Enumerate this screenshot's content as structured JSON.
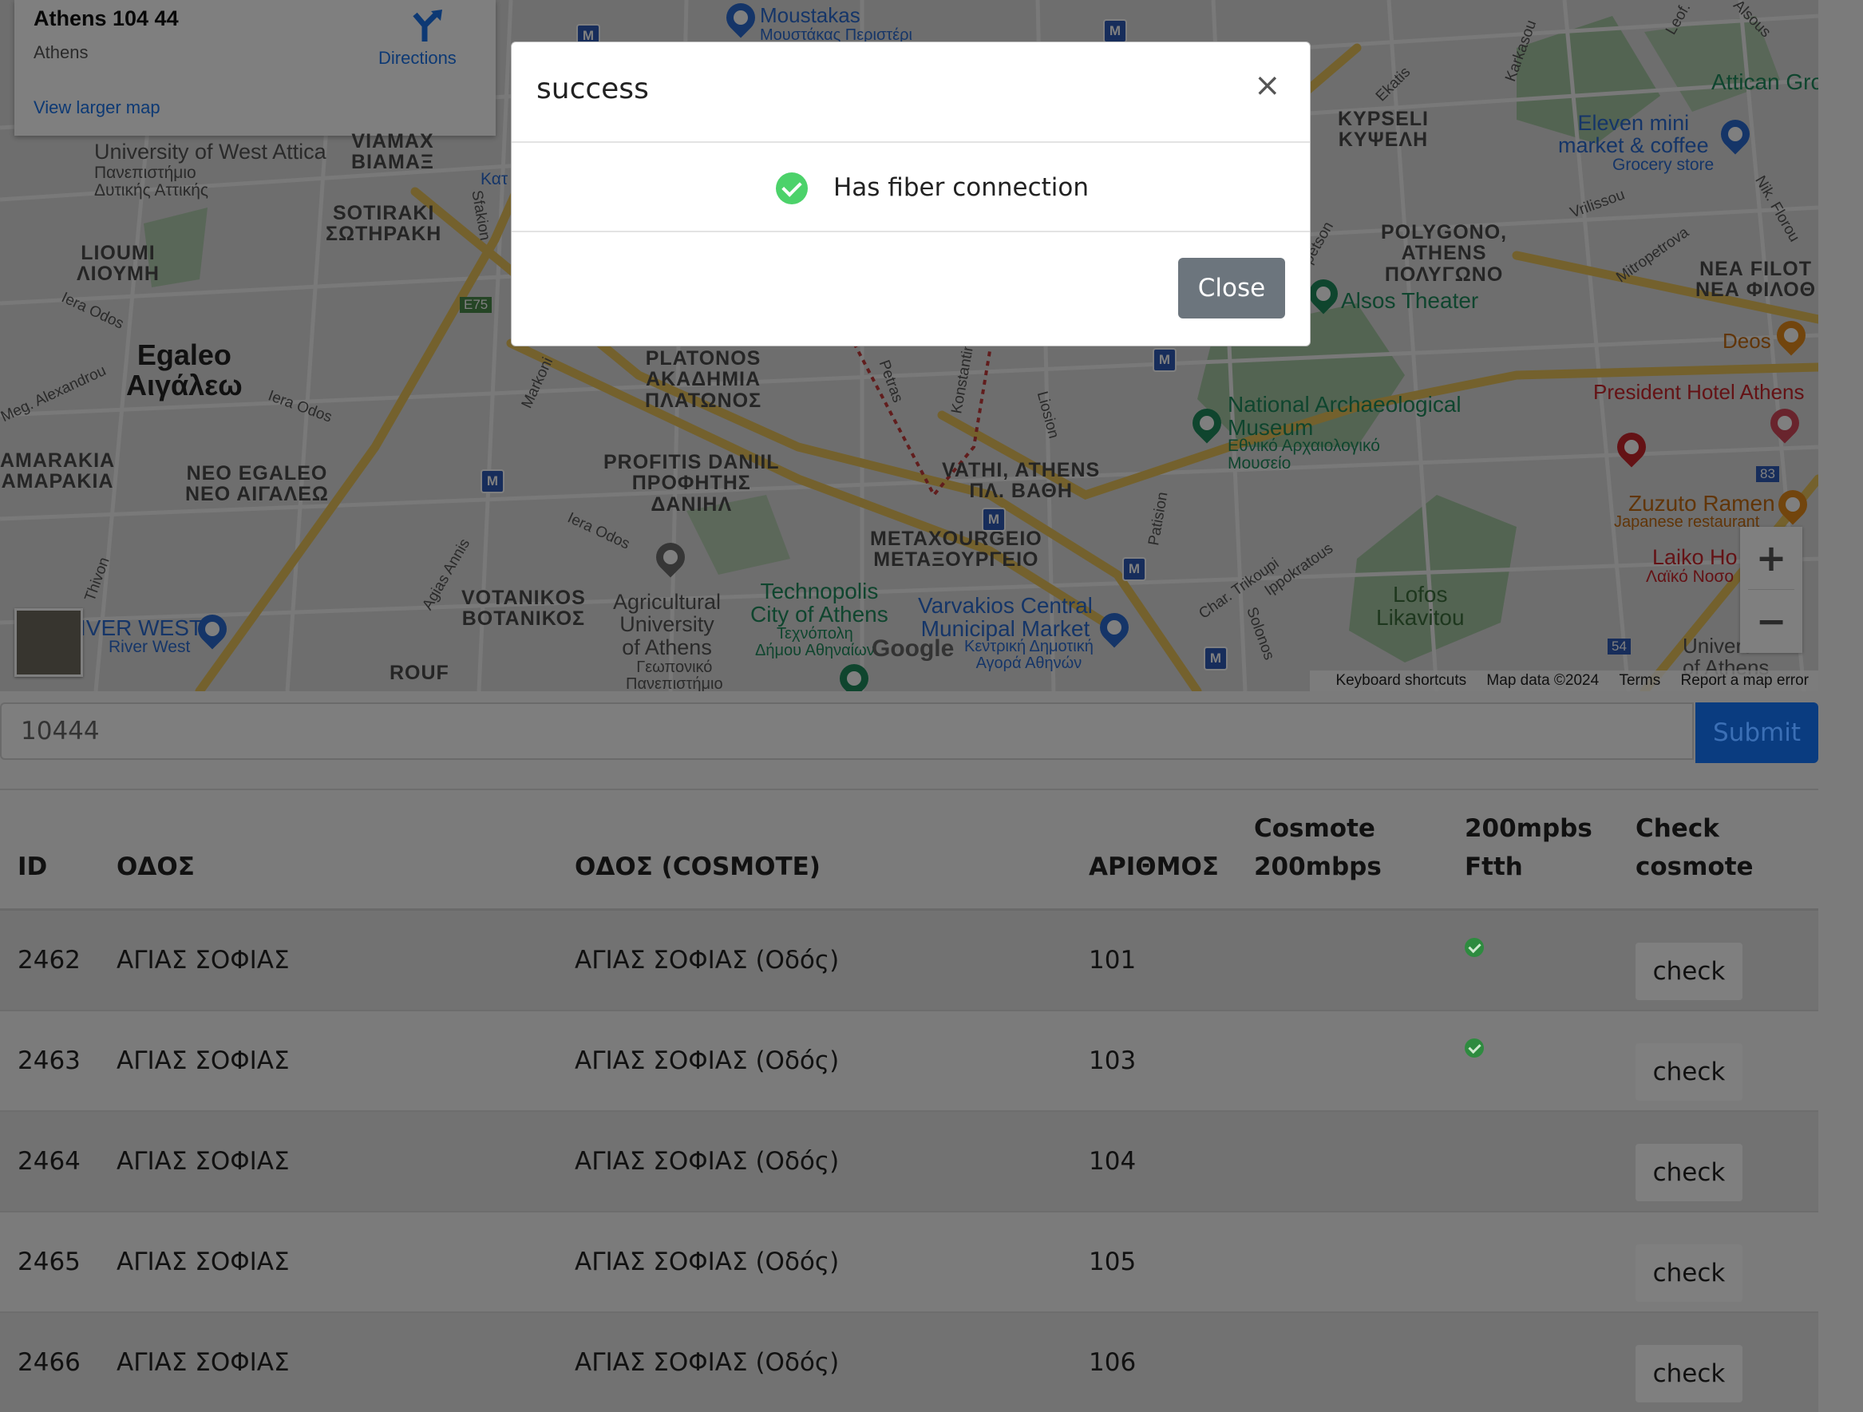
{
  "map": {
    "info_card": {
      "address": "Athens 104 44",
      "city": "Athens",
      "directions_label": "Directions",
      "larger_map_label": "View larger map"
    },
    "labels": {
      "moustakas": "Moustakas",
      "moustakas_gr": "Μουστάκας Περιστέρι",
      "university_wa": "University of West Attica",
      "university_wa_gr": "Πανεπιστήμιο\nΔυτικής Αττικής",
      "viamax": "VIAMAX\nΒΙΑΜΑΞ",
      "sotiraki": "SOTIRAKI\nΣΩΤΗΡΑΚΗ",
      "liomi": "LIOUMI\nΛΙΟΥΜΗ",
      "egaleo": "Egaleo\nΑιγάλεω",
      "amarakia": "AMARAKIA\nΑΜΑΡΑΚΙΑ",
      "neo_egaleo": "NEO EGALEO\nΝΕΟ ΑΙΓΑΛΕΩ",
      "platonos": "PLATONOS\nΑΚΑΔΗΜΙΑ\nΠΛΑΤΩΝΟΣ",
      "profitis": "PROFITIS DANIIL\nΠΡΟΦΗΤΗΣ\nΔΑΝΙΗΛ",
      "votanikos": "VOTANIKOS\nΒΟΤΑΝΙΚΟΣ",
      "agri_univ": "Agricultural\nUniversity\nof Athens",
      "agri_univ_gr": "Γεωπονικό\nΠανεπιστήμιο",
      "vathi": "VATHI, ATHENS\nΠΛ. ΒΑΘΗ",
      "metaxourgeio": "METAXOURGEIO\nΜΕΤΑΞΟΥΡΓΕΙΟ",
      "technopolis": "Technopolis\nCity of Athens",
      "technopolis_gr": "Τεχνόπολη\nΔήμου Αθηναίων",
      "varvakios": "Varvakios Central\nMunicipal Market",
      "varvakios_gr": "Κεντρική Δημοτική\nΑγορά Αθηνών",
      "river_west": "IVER WEST",
      "river_west_2": "River West",
      "rouf": "ROUF",
      "kypseli": "KYPSELI\nΚΥΨΕΛΗ",
      "polygono": "POLYGONO,\nATHENS\nΠΟΛΥΓΩΝΟ",
      "alsos": "Alsos Theater",
      "eleven": "Eleven mini\nmarket & coffee",
      "grocery": "Grocery store",
      "attican": "Attican Gro",
      "nea_filot": "ΝΕΑ FILOT\nΝΕΑ ΦΙΛΟΘ",
      "deos": "Deos",
      "president": "President Hotel Athens",
      "museum": "National Archaeological\nMuseum",
      "museum_gr": "Εθνικό Αρχαιολογικό\nΜουσείο",
      "zuzuto": "Zuzuto Ramen",
      "zuzuto_sub": "Japanese restaurant",
      "laiko": "Laiko Ho",
      "laiko_gr": "Λαϊκό Νοσο",
      "lofos": "Lofos\nLikavitou",
      "university_right": "Univers\nof Athens",
      "street_iera1": "Iera Odos",
      "street_iera2": "Iera Odos",
      "street_iera3": "Iera Odos",
      "street_meg_alex": "Meg. Alexandrou",
      "street_thivon": "Thivon",
      "street_markoni": "Markoni",
      "street_agias_annis": "Agias Annis",
      "street_petras": "Petras",
      "street_konstantin": "Konstantin",
      "street_liosion": "Liosion",
      "street_patision": "Patision",
      "street_char_trikoupi": "Char. Trikoupi",
      "street_ippokratous": "Ippokratous",
      "street_solonos": "Solonos",
      "street_sfakion": "Sfakion",
      "street_ekatis": "Ekatis",
      "street_karkasou": "Karkasou",
      "street_vrilissou": "Vrilissou",
      "street_mitropetrova": "Mitropetrova",
      "street_nik_florou": "Nik. Florou",
      "street_spetson": "Spetson",
      "street_leof": "Leof.",
      "street_alsous": "Alsous",
      "e75": "E75",
      "route_83": "83",
      "route_54": "54",
      "kat": "Κατ"
    },
    "google_logo": "Google",
    "footer": {
      "shortcuts": "Keyboard shortcuts",
      "map_data": "Map data ©2024",
      "terms": "Terms",
      "report": "Report a map error"
    },
    "zoom_in": "+",
    "zoom_out": "−"
  },
  "search": {
    "value": "10444",
    "submit_label": "Submit"
  },
  "table": {
    "headers": [
      "ID",
      "ΟΔΟΣ",
      "ΟΔΟΣ (COSMOTE)",
      "ΑΡΙΘΜΟΣ",
      "Cosmote 200mbps",
      "200mpbs Ftth",
      "Check cosmote"
    ],
    "header_lines": {
      "cosmote_1": "Cosmote",
      "cosmote_2": "200mbps",
      "ftth_1": "200mpbs",
      "ftth_2": "Ftth",
      "check_1": "Check",
      "check_2": "cosmote"
    },
    "rows": [
      {
        "id": "2462",
        "street": "ΑΓΙΑΣ ΣΟΦΙΑΣ",
        "street_cosmote": "ΑΓΙΑΣ ΣΟΦΙΑΣ (Οδός)",
        "number": "101",
        "cosmote_200": "",
        "ftth": true,
        "check_label": "check"
      },
      {
        "id": "2463",
        "street": "ΑΓΙΑΣ ΣΟΦΙΑΣ",
        "street_cosmote": "ΑΓΙΑΣ ΣΟΦΙΑΣ (Οδός)",
        "number": "103",
        "cosmote_200": "",
        "ftth": true,
        "check_label": "check"
      },
      {
        "id": "2464",
        "street": "ΑΓΙΑΣ ΣΟΦΙΑΣ",
        "street_cosmote": "ΑΓΙΑΣ ΣΟΦΙΑΣ (Οδός)",
        "number": "104",
        "cosmote_200": "",
        "ftth": false,
        "check_label": "check"
      },
      {
        "id": "2465",
        "street": "ΑΓΙΑΣ ΣΟΦΙΑΣ",
        "street_cosmote": "ΑΓΙΑΣ ΣΟΦΙΑΣ (Οδός)",
        "number": "105",
        "cosmote_200": "",
        "ftth": false,
        "check_label": "check"
      },
      {
        "id": "2466",
        "street": "ΑΓΙΑΣ ΣΟΦΙΑΣ",
        "street_cosmote": "ΑΓΙΑΣ ΣΟΦΙΑΣ (Οδός)",
        "number": "106",
        "cosmote_200": "",
        "ftth": false,
        "check_label": "check"
      }
    ]
  },
  "modal": {
    "title": "success",
    "close_icon": "×",
    "message": "Has fiber connection",
    "close_button": "Close",
    "success_color": "#4cd26a"
  },
  "colors": {
    "primary": "#0a3c80",
    "ftth_check": "#2e8b3f",
    "modal_button": "#6c757d"
  }
}
